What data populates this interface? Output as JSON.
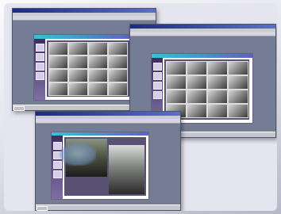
{
  "screenshot": {
    "windows": [
      {
        "id": "window-1",
        "title_bar": "",
        "taskbar_label": "",
        "grid": {
          "rows": 4,
          "cols": 4
        }
      },
      {
        "id": "window-2",
        "title_bar": "",
        "taskbar_label": "",
        "grid": {
          "rows": 4,
          "cols": 4
        }
      },
      {
        "id": "window-3",
        "title_bar": "",
        "taskbar_label": "",
        "grid": {
          "rows": 1,
          "cols": 2
        }
      }
    ]
  },
  "colors": {
    "desktop": "#757d95",
    "app_header": "#38c2d2",
    "sidebar": "#3c2f5e",
    "content": "#5a5275"
  }
}
